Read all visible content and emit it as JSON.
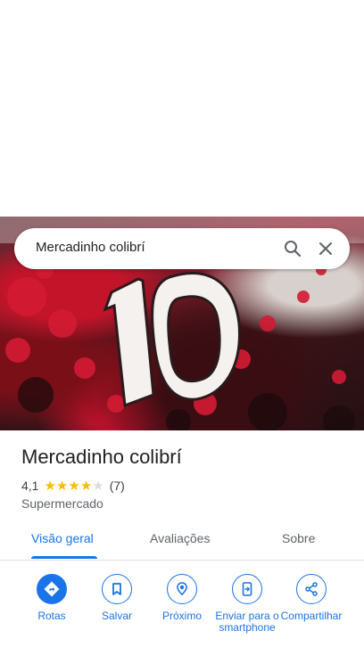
{
  "search": {
    "query": "Mercadinho colibrí"
  },
  "place": {
    "name": "Mercadinho colibrí",
    "rating": "4,1",
    "stars": 4.1,
    "review_count": "(7)",
    "category": "Supermercado"
  },
  "tabs": [
    {
      "label": "Visão geral",
      "active": true
    },
    {
      "label": "Avaliações",
      "active": false
    },
    {
      "label": "Sobre",
      "active": false
    }
  ],
  "actions": [
    {
      "label": "Rotas",
      "icon": "directions-icon"
    },
    {
      "label": "Salvar",
      "icon": "bookmark-icon"
    },
    {
      "label": "Próximo",
      "icon": "nearby-icon"
    },
    {
      "label": "Enviar para o smartphone",
      "icon": "send-to-phone-icon"
    },
    {
      "label": "Compartilhar",
      "icon": "share-icon"
    }
  ],
  "colors": {
    "accent": "#1a73e8",
    "star": "#fbbc04",
    "text": "#202124",
    "secondary_text": "#5f6368"
  }
}
